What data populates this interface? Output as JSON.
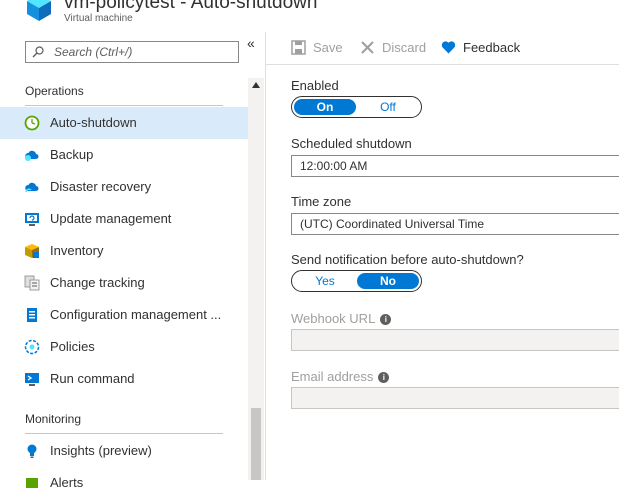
{
  "header": {
    "title": "vm-policytest - Auto-shutdown",
    "subtitle": "Virtual machine",
    "collapse_glyph": "«"
  },
  "sidebar": {
    "search_placeholder": "Search (Ctrl+/)",
    "sections": [
      {
        "title": "Operations",
        "items": [
          {
            "label": "Auto-shutdown",
            "icon": "clock-icon",
            "active": true
          },
          {
            "label": "Backup",
            "icon": "cloud-backup-icon"
          },
          {
            "label": "Disaster recovery",
            "icon": "cloud-recovery-icon"
          },
          {
            "label": "Update management",
            "icon": "update-monitor-icon"
          },
          {
            "label": "Inventory",
            "icon": "inventory-box-icon"
          },
          {
            "label": "Change tracking",
            "icon": "change-tracking-icon"
          },
          {
            "label": "Configuration management ...",
            "icon": "configuration-icon"
          },
          {
            "label": "Policies",
            "icon": "policy-icon"
          },
          {
            "label": "Run command",
            "icon": "run-command-icon"
          }
        ]
      },
      {
        "title": "Monitoring",
        "items": [
          {
            "label": "Insights (preview)",
            "icon": "lightbulb-icon"
          },
          {
            "label": "Alerts",
            "icon": "alert-icon"
          }
        ]
      }
    ]
  },
  "toolbar": {
    "save_label": "Save",
    "discard_label": "Discard",
    "feedback_label": "Feedback"
  },
  "form": {
    "enabled": {
      "label": "Enabled",
      "on": "On",
      "off": "Off",
      "value": "On"
    },
    "scheduled_shutdown": {
      "label": "Scheduled shutdown",
      "value": "12:00:00 AM"
    },
    "time_zone": {
      "label": "Time zone",
      "value": "(UTC) Coordinated Universal Time"
    },
    "notification": {
      "label": "Send notification before auto-shutdown?",
      "yes": "Yes",
      "no": "No",
      "value": "No"
    },
    "webhook_url": {
      "label": "Webhook URL",
      "value": ""
    },
    "email_address": {
      "label": "Email address",
      "value": ""
    }
  },
  "colors": {
    "accent": "#0078d4",
    "active_nav_bg": "#d9ebfb",
    "disabled_text": "#a19f9d"
  }
}
